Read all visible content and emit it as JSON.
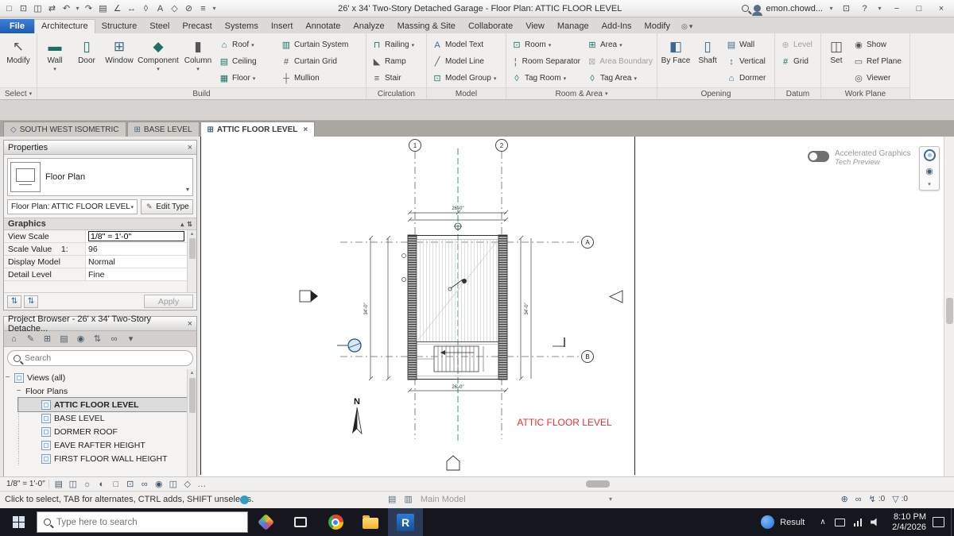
{
  "titlebar": {
    "title": "26' x 34' Two-Story Detached Garage - Floor Plan: ATTIC FLOOR LEVEL",
    "user": "emon.chowd..."
  },
  "tabs": [
    "File",
    "Architecture",
    "Structure",
    "Steel",
    "Precast",
    "Systems",
    "Insert",
    "Annotate",
    "Analyze",
    "Massing & Site",
    "Collaborate",
    "View",
    "Manage",
    "Add-Ins",
    "Modify"
  ],
  "ribbon": {
    "select": {
      "modify": "Modify",
      "footer": "Select"
    },
    "build": {
      "big": [
        "Wall",
        "Door",
        "Window",
        "Component",
        "Column"
      ],
      "col1": [
        "Roof",
        "Ceiling",
        "Floor"
      ],
      "col2": [
        "Curtain System",
        "Curtain Grid",
        "Mullion"
      ],
      "footer": "Build"
    },
    "circulation": {
      "items": [
        "Railing",
        "Ramp",
        "Stair"
      ],
      "footer": "Circulation"
    },
    "model": {
      "items": [
        "Model Text",
        "Model Line",
        "Model Group"
      ],
      "footer": "Model"
    },
    "room_area": {
      "col1": [
        "Room",
        "Room Separator",
        "Tag Room"
      ],
      "col2": [
        "Area",
        "Area Boundary",
        "Tag Area"
      ],
      "footer": "Room & Area"
    },
    "opening": {
      "big": [
        "By Face",
        "Shaft"
      ],
      "small": [
        "Wall",
        "Vertical",
        "Dormer"
      ],
      "footer": "Opening"
    },
    "datum": {
      "items": [
        "Level",
        "Grid"
      ],
      "footer": "Datum"
    },
    "workplane": {
      "big": "Set",
      "small": [
        "Show",
        "Ref Plane",
        "Viewer"
      ],
      "footer": "Work Plane"
    }
  },
  "view_tabs": [
    "SOUTH WEST ISOMETRIC",
    "BASE LEVEL",
    "ATTIC FLOOR LEVEL"
  ],
  "properties": {
    "header": "Properties",
    "type_name": "Floor Plan",
    "instance": "Floor Plan: ATTIC FLOOR LEVEL",
    "edit_type": "Edit Type",
    "group": "Graphics",
    "rows": [
      {
        "label": "View Scale",
        "value": "1/8\" = 1'-0\""
      },
      {
        "label": "Scale Value    1:",
        "value": "96"
      },
      {
        "label": "Display Model",
        "value": "Normal"
      },
      {
        "label": "Detail Level",
        "value": "Fine"
      }
    ],
    "apply": "Apply"
  },
  "browser": {
    "header": "Project Browser - 26' x 34' Two-Story Detache...",
    "search_placeholder": "Search",
    "root": "Views (all)",
    "group": "Floor Plans",
    "items": [
      "ATTIC FLOOR LEVEL",
      "BASE LEVEL",
      "DORMER ROOF",
      "EAVE RAFTER HEIGHT",
      "FIRST FLOOR WALL HEIGHT"
    ]
  },
  "canvas": {
    "accel_title": "Accelerated Graphics",
    "accel_sub": "Tech Preview",
    "grid_bubbles": [
      "1",
      "2",
      "A",
      "B"
    ],
    "north": "N",
    "view_label": "ATTIC FLOOR LEVEL",
    "dim_width": "26'-0\"",
    "dim_height": "34'-0\"",
    "colors": {
      "view_label": "#e8312a",
      "centerline": "#2ca05a"
    }
  },
  "view_bar": {
    "scale": "1/8\" = 1'-0\""
  },
  "status": {
    "hint": "Click to select, TAB for alternates, CTRL adds, SHIFT unselects.",
    "main_model": "Main Model",
    "count_a": ":0",
    "count_b": ":0"
  },
  "taskbar": {
    "search_placeholder": "Type here to search",
    "widget": "Result",
    "time": "8:10 PM",
    "date": "2/4/2026"
  },
  "icons": {
    "i_new": "□",
    "i_open": "⊡",
    "i_save": "◫",
    "i_sync": "⇄",
    "i_undo": "↶",
    "i_redo": "↷",
    "i_print": "▤",
    "i_measure": "∠",
    "i_dim": "↔",
    "i_tag": "◊",
    "i_text": "A",
    "i_view3d": "◇",
    "i_section": "⊘",
    "i_thin": "≡",
    "i_dd": "▾",
    "i_help": "?",
    "i_min": "−",
    "i_max": "□",
    "i_close": "×",
    "i_modify": "↖",
    "wall": "▬",
    "door": "▯",
    "window": "⊞",
    "component": "◆",
    "column": "▮",
    "roof": "⌂",
    "ceiling": "▤",
    "floor": "▦",
    "curtain_system": "▥",
    "curtain_grid": "#",
    "mullion": "┼",
    "railing": "⊓",
    "ramp": "◣",
    "stair": "≡",
    "model_text": "A",
    "model_line": "╱",
    "model_group": "⊡",
    "room": "⊡",
    "room_sep": "¦",
    "tag_room": "◊",
    "area": "⊞",
    "area_boundary": "⊠",
    "tag_area": "◊",
    "by_face": "◧",
    "shaft": "▯",
    "o_wall": "▤",
    "o_vert": "↕",
    "dormer": "⌂",
    "level": "⊕",
    "grid": "#",
    "set": "◫",
    "show": "◉",
    "ref_plane": "▭",
    "viewer": "◎",
    "i_plan": "⊞",
    "b_home": "⌂",
    "b_edit": "✎",
    "b_grid": "⊞",
    "b_list": "▤",
    "b_eye": "◉",
    "b_sort": "⇅",
    "b_link": "∞",
    "b_dd": "▾",
    "v_detail": "▤",
    "v_style": "◫",
    "v_sun": "☼",
    "v_shadow": "◐",
    "v_crop": "□",
    "v_cropvis": "⊡",
    "v_hide": "∞",
    "v_reveal": "◉",
    "v_lock": "◫",
    "v_iso": "◇",
    "v_more": "…",
    "s_doc": "▤",
    "s_doc2": "▥",
    "s_pan": "⊕",
    "s_glasses": "∞",
    "s_bolt": "↯",
    "s_funnel": "▽",
    "caret": "∧",
    "exp": "−"
  }
}
